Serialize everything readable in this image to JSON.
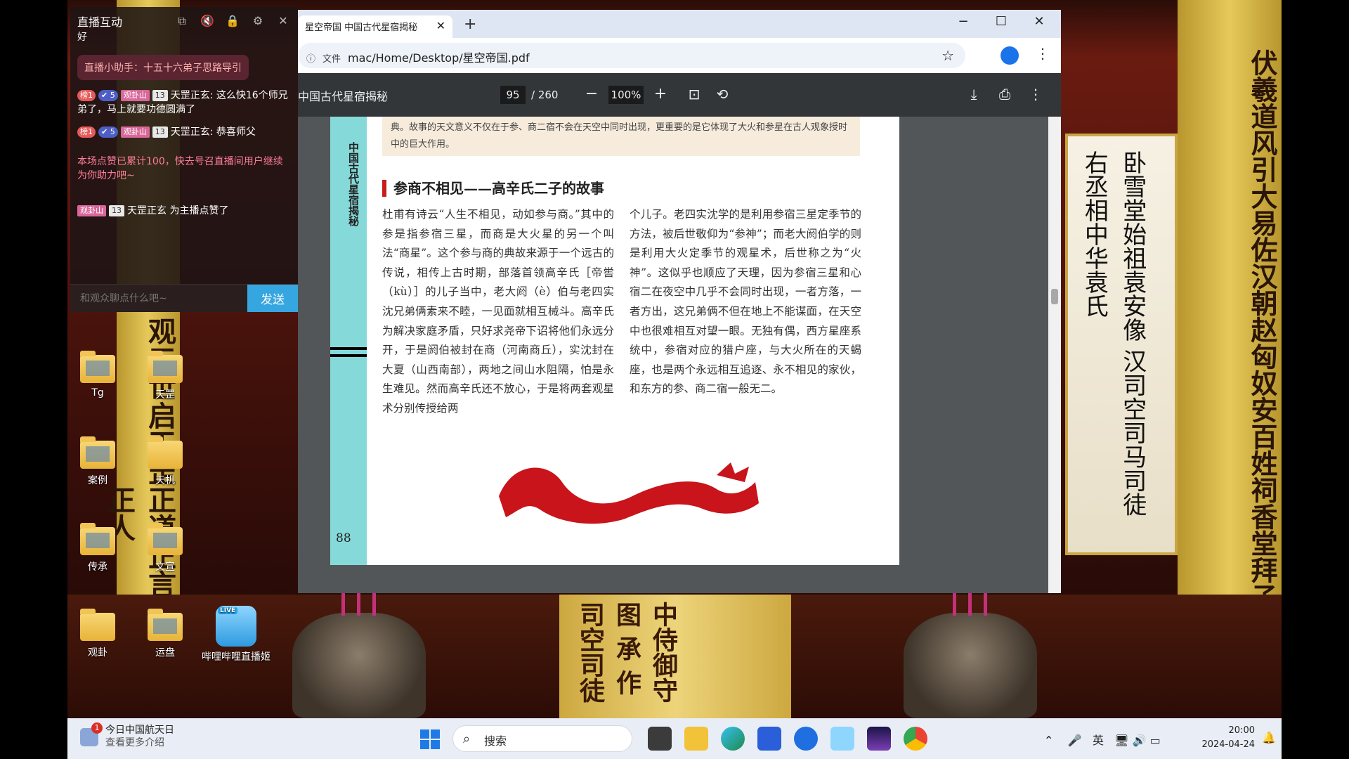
{
  "desktop": {
    "left_pillar_text": "观三世启天罡正道正言正身正心正人",
    "right_pillar_text": "伏羲道风引大易佐汉朝赵匈奴安百姓祠香堂拜子孙二千年",
    "plaque_text": "卧雪堂始祖袁安像 汉司空司马司徒右丞相中华袁氏",
    "center_scroll_text": "中侍御守图 承 作司空司徒",
    "icons": [
      {
        "label": "Tg"
      },
      {
        "label": "天罡"
      },
      {
        "label": "案例"
      },
      {
        "label": "天机"
      },
      {
        "label": "传承"
      },
      {
        "label": "文宣"
      },
      {
        "label": "观卦"
      },
      {
        "label": "运盘"
      },
      {
        "label": "哔哩哔哩直播姬",
        "badge": "LIVE"
      }
    ]
  },
  "chat": {
    "title": "直播互动",
    "first_line": "好",
    "assistant": "直播小助手：十五十六弟子思路导引",
    "messages": [
      {
        "rank": "榜1",
        "v": "5",
        "medal": "观卦山",
        "level": "13",
        "text": "天罡正玄: 这么快16个师兄弟了，马上就要功德圆满了"
      },
      {
        "rank": "榜1",
        "v": "5",
        "medal": "观卦山",
        "level": "13",
        "text": "天罡正玄: 恭喜师父"
      }
    ],
    "notice": "本场点赞已累计100，快去号召直播间用户继续为你助力吧~",
    "like_medal": "观卦山",
    "like_level": "13",
    "like_text": "天罡正玄 为主播点赞了",
    "input_placeholder": "和观众聊点什么吧~",
    "send_label": "发送"
  },
  "browser": {
    "tab_title": "星空帝国 中国古代星宿揭秘",
    "address_scheme": "文件",
    "address": "mac/Home/Desktop/星空帝国.pdf",
    "doc_title": "中国古代星宿揭秘",
    "page_current": "95",
    "page_total": "/ 260",
    "zoom": "100%"
  },
  "pdf": {
    "strip_title": "中国古代星宿揭秘",
    "page_number": "88",
    "top_note": "典。故事的天文意义不仅在于参、商二宿不会在天空中同时出现，更重要的是它体现了大火和参星在古人观象授时中的巨大作用。",
    "section_title": "参商不相见——高辛氏二子的故事",
    "col1": "杜甫有诗云“人生不相见，动如参与商。”其中的参是指参宿三星，而商是大火星的另一个叫法“商星”。这个参与商的典故来源于一个远古的传说，相传上古时期，部落首领高辛氏［帝喾（kù）］的儿子当中，老大阏（è）伯与老四实沈兄弟俩素来不睦，一见面就相互械斗。高辛氏为解决家庭矛盾，只好求尧帝下诏将他们永远分开，于是阏伯被封在商（河南商丘），实沈封在大夏（山西南部），两地之间山水阻隔，怕是永生难见。然而高辛氏还不放心，于是将两套观星术分别传授给两",
    "col2": "个儿子。老四实沈学的是利用参宿三星定季节的方法，被后世敬仰为“参神”；而老大阏伯学的则是利用大火定季节的观星术，后世称之为“火神”。这似乎也顺应了天理，因为参宿三星和心宿二在夜空中几乎不会同时出现，一者方落，一者方出，这兄弟俩不但在地上不能谋面，在天空中也很难相互对望一眼。无独有偶，西方星座系统中，参宿对应的猎户座，与大火所在的天蝎座，也是两个永远相互追逐、永不相见的家伙，和东方的参、商二宿一般无二。"
  },
  "taskbar": {
    "weather_title": "今日中国航天日",
    "weather_sub": "查看更多介绍",
    "weather_badge": "1",
    "search_placeholder": "搜索",
    "ime": "英",
    "time": "20:00",
    "date": "2024-04-24"
  }
}
